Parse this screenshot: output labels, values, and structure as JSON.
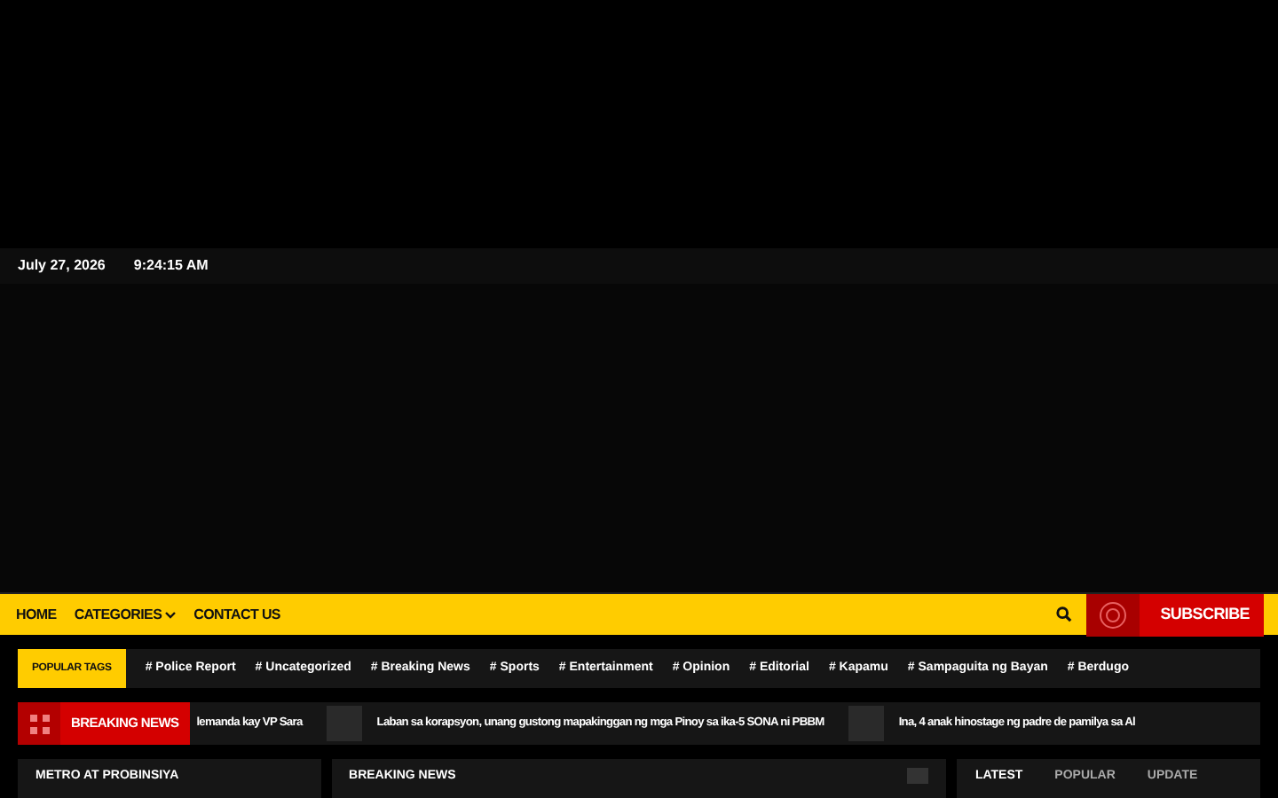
{
  "topbar": {
    "date": "July 27, 2026",
    "time": "9:24:15 AM"
  },
  "nav": {
    "items": [
      {
        "label": "HOME",
        "dropdown": false
      },
      {
        "label": "CATEGORIES",
        "dropdown": true
      },
      {
        "label": "CONTACT US",
        "dropdown": false
      }
    ],
    "subscribe": "SUBSCRIBE"
  },
  "popular_tags": {
    "label": "POPULAR TAGS",
    "tags": [
      "# Police Report",
      "# Uncategorized",
      "# Breaking News",
      "# Sports",
      "# Entertainment",
      "# Opinion",
      "# Editorial",
      "# Kapamu",
      "# Sampaguita ng Bayan",
      "# Berdugo"
    ]
  },
  "breaking": {
    "label": "BREAKING NEWS",
    "items": [
      {
        "title": "lemanda kay VP Sara",
        "thumb": false
      },
      {
        "title": "Laban sa korapsyon, unang gustong mapakinggan ng mga Pinoy sa ika-5 SONA ni PBBM",
        "thumb": true
      },
      {
        "title": "Ina, 4 anak hinostage ng padre de pamilya sa Al",
        "thumb": true
      }
    ]
  },
  "sections": [
    {
      "title": "METRO AT PROBINSIYA",
      "kind": "plain"
    },
    {
      "title": "BREAKING NEWS",
      "kind": "slider"
    },
    {
      "kind": "tabs",
      "tabs": [
        {
          "label": "LATEST",
          "selected": true
        },
        {
          "label": "POPULAR",
          "selected": false
        },
        {
          "label": "UPDATE",
          "selected": false
        }
      ]
    }
  ]
}
